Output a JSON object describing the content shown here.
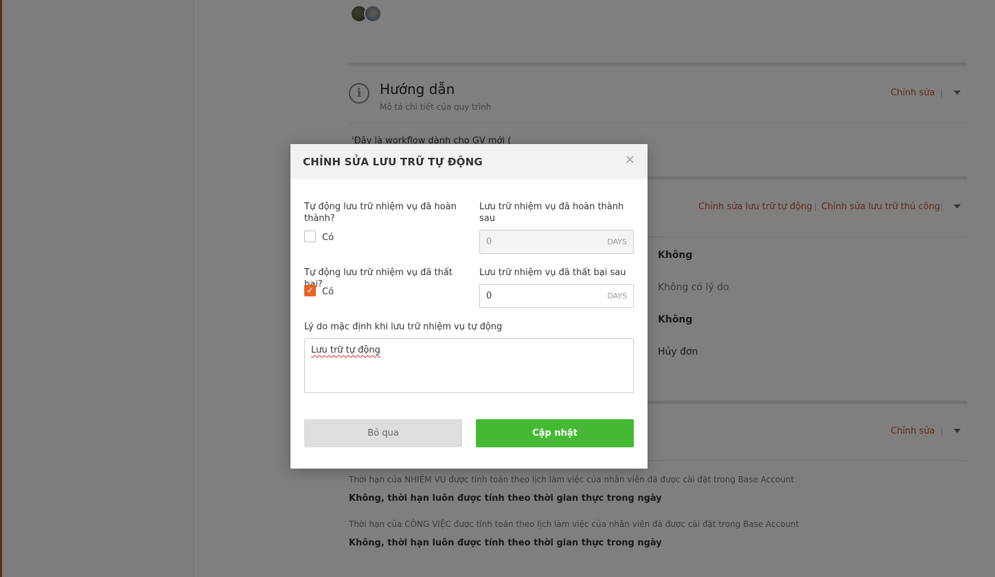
{
  "background": {
    "guide": {
      "title": "Hướng dẫn",
      "subtitle": "Mô tả chi tiết của quy trình",
      "edit_label": "Chỉnh sửa",
      "body": "'Đây là workflow dành cho GV mới ("
    },
    "archive": {
      "auto_edit_label": "Chỉnh sửa lưu trữ tự động",
      "manual_edit_label": "Chỉnh sửa lưu trữ thủ công",
      "values": [
        "Không",
        "Không có lý do",
        "Không",
        "Hủy đơn"
      ]
    },
    "deadline": {
      "edit_label": "Chỉnh sửa",
      "task_note": "Thời hạn của NHIỆM VỤ được tính toán theo lịch làm việc của nhân viên đã được cài đặt trong Base Account",
      "task_value": "Không, thời hạn luôn được tính theo thời gian thực trong ngày",
      "job_note": "Thời hạn của CÔNG VIỆC được tính toán theo lịch làm việc của nhân viên đã được cài đặt trong Base Account",
      "job_value": "Không, thời hạn luôn được tính theo thời gian thực trong ngày"
    }
  },
  "modal": {
    "title": "CHỈNH SỬA LƯU TRỮ TỰ ĐỘNG",
    "close_symbol": "×",
    "completed": {
      "label": "Tự động lưu trữ nhiệm vụ đã hoàn thành?",
      "checkbox_label": "Có",
      "checked": false,
      "after_label": "Lưu trữ nhiệm vụ đã hoàn thành sau",
      "after_value": "0",
      "unit": "DAYS",
      "disabled": true
    },
    "failed": {
      "label": "Tự động lưu trữ nhiệm vụ đã thất bại?",
      "checkbox_label": "Có",
      "checked": true,
      "check_symbol": "✓",
      "after_label": "Lưu trữ nhiệm vụ đã thất bại sau",
      "after_value": "0",
      "unit": "DAYS",
      "disabled": false
    },
    "reason": {
      "label": "Lý do mặc định khi lưu trữ nhiệm vụ tự động",
      "value": "Lưu trữ tự động"
    },
    "cancel_label": "Bỏ qua",
    "update_label": "Cập nhật"
  },
  "colors": {
    "accent": "#c0522a",
    "checkbox_checked": "#e8632b",
    "primary_button": "#46b934",
    "overlay": "rgba(0,0,0,0.5)"
  }
}
